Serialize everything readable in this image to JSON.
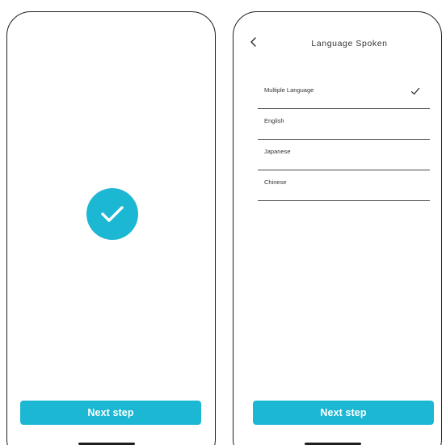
{
  "screens": [
    {
      "id": "success",
      "cta_label": "Next step",
      "colors": {
        "accent": "#1bb7d3"
      },
      "icons": [
        "check-circle-icon"
      ]
    },
    {
      "id": "language",
      "title": "Language Spoken",
      "back_icon": "chevron-left-icon",
      "languages": [
        {
          "label": "Multiple Language",
          "selected": true
        },
        {
          "label": "English",
          "selected": false
        },
        {
          "label": "Japanese",
          "selected": false
        },
        {
          "label": "Chinese",
          "selected": false
        }
      ],
      "cta_label": "Next step",
      "colors": {
        "accent": "#1bb7d3"
      }
    }
  ]
}
